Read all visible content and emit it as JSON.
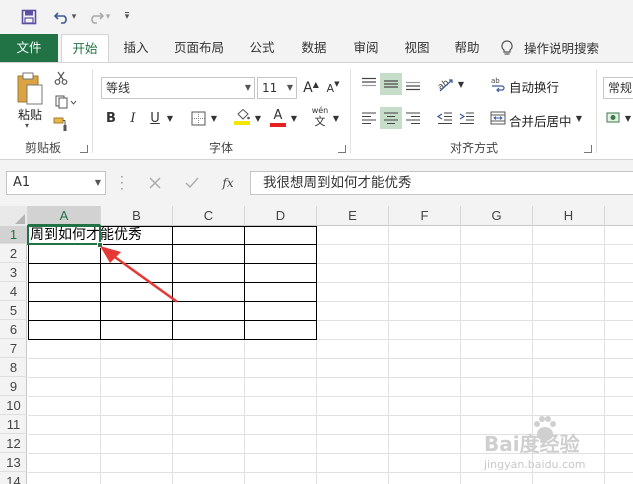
{
  "qat": {
    "undo_arrow": "▾",
    "redo_arrow": "▾",
    "customize": "▾"
  },
  "tabs": [
    "文件",
    "开始",
    "插入",
    "页面布局",
    "公式",
    "数据",
    "审阅",
    "视图",
    "帮助"
  ],
  "tell_me": "操作说明搜索",
  "ribbon": {
    "clipboard": {
      "paste_label": "粘贴",
      "group_label": "剪贴板"
    },
    "font": {
      "font_name": "等线",
      "font_size": "11",
      "bold": "B",
      "italic": "I",
      "underline": "U",
      "grow": "A",
      "shrink": "A",
      "font_color_glyph": "A",
      "phonetic": "wén",
      "group_label": "字体"
    },
    "alignment": {
      "wrap_text": "自动换行",
      "merge_center": "合并后居中",
      "group_label": "对齐方式"
    },
    "number": {
      "format": "常规"
    }
  },
  "formula_bar": {
    "name_box": "A1",
    "fx": "fx",
    "content": "我很想周到如何才能优秀"
  },
  "grid": {
    "columns": [
      "A",
      "B",
      "C",
      "D",
      "E",
      "F",
      "G",
      "H"
    ],
    "rows": [
      "1",
      "2",
      "3",
      "4",
      "5",
      "6",
      "7",
      "8",
      "9",
      "10",
      "11",
      "12",
      "13",
      "14"
    ],
    "a1_value": "周到如何才能优秀"
  },
  "watermark": {
    "brand": "Bai度经验",
    "url": "jingyan.baidu.com"
  },
  "colors": {
    "excel_green": "#217346",
    "arrow_red": "#e53935"
  }
}
